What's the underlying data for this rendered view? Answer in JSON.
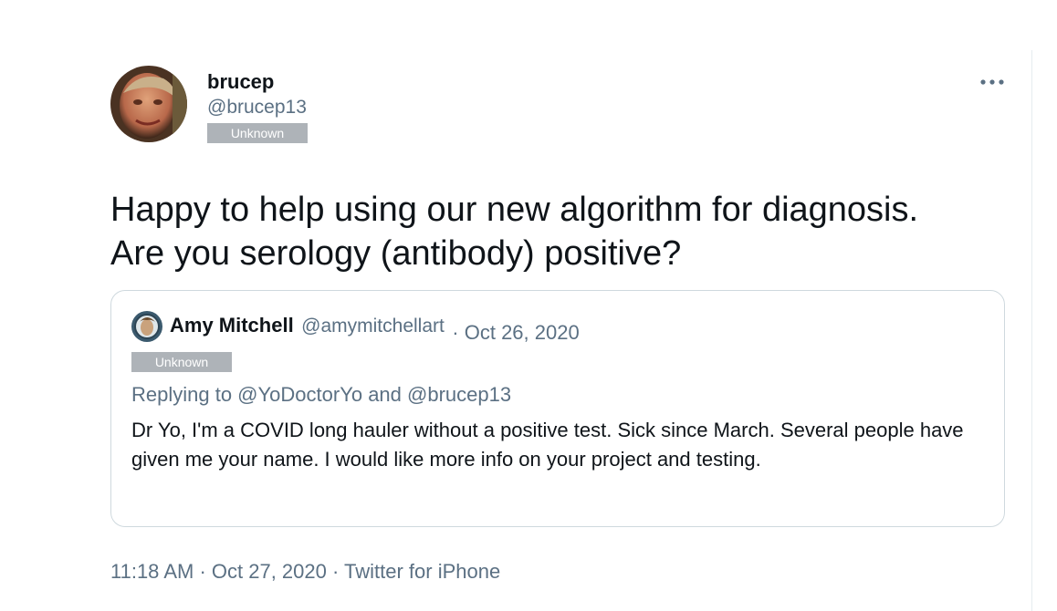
{
  "tweet": {
    "display_name": "brucep",
    "handle": "@brucep13",
    "badge": "Unknown",
    "more_icon": "more-horizontal-icon",
    "text_line1": "Happy to help using our new algorithm for diagnosis.",
    "text_line2": "Are you serology (antibody) positive?"
  },
  "quoted_tweet": {
    "display_name": "Amy Mitchell",
    "handle": "@amymitchellart",
    "date": "· Oct 26, 2020",
    "badge": "Unknown",
    "replying_to": "Replying to @YoDoctorYo and @brucep13",
    "text": "Dr Yo, I'm a COVID long hauler without a positive test. Sick since March. Several people have given me your name. I would like more info on your project and testing."
  },
  "meta": {
    "time": "11:18 AM",
    "sep1": " · ",
    "date": "Oct 27, 2020",
    "sep2": " · ",
    "source": "Twitter for iPhone"
  }
}
